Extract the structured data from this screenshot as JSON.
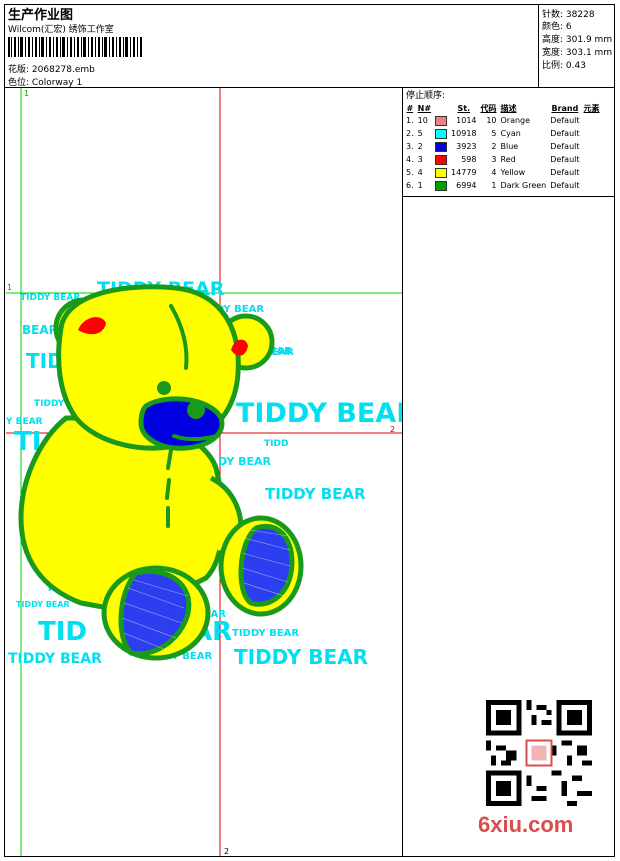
{
  "header": {
    "title": "生产作业图",
    "subtitle": "Wilcom(汇宏) 绣饰工作室",
    "design_file_label": "花版:",
    "design_file": "2068278.emb",
    "colorway_label": "色位:",
    "colorway": "Colorway 1"
  },
  "stats": {
    "stitches_label": "针数:",
    "stitches": "38228",
    "colors_label": "颜色:",
    "colors": "6",
    "height_label": "高度:",
    "height": "301.9 mm",
    "width_label": "宽度:",
    "width": "303.1 mm",
    "scale_label": "比例:",
    "scale": "0.43"
  },
  "stop_sequence": {
    "title": "停止顺序:",
    "headers": [
      "#",
      "N#",
      "St.",
      "代码",
      "描述",
      "Brand",
      "元素"
    ],
    "rows": [
      {
        "index": "1.",
        "n": "10",
        "color": "#f08080",
        "stitches": "1014",
        "code": "10",
        "desc": "Orange",
        "brand": "Default"
      },
      {
        "index": "2.",
        "n": "5",
        "color": "#00ffff",
        "stitches": "10918",
        "code": "5",
        "desc": "Cyan",
        "brand": "Default"
      },
      {
        "index": "3.",
        "n": "2",
        "color": "#0000e0",
        "stitches": "3923",
        "code": "2",
        "desc": "Blue",
        "brand": "Default"
      },
      {
        "index": "4.",
        "n": "3",
        "color": "#ff0000",
        "stitches": "598",
        "code": "3",
        "desc": "Red",
        "brand": "Default"
      },
      {
        "index": "5.",
        "n": "4",
        "color": "#ffff00",
        "stitches": "14779",
        "code": "4",
        "desc": "Yellow",
        "brand": "Default"
      },
      {
        "index": "6.",
        "n": "1",
        "color": "#00a000",
        "stitches": "6994",
        "code": "1",
        "desc": "Dark Green",
        "brand": "Default"
      }
    ]
  },
  "design": {
    "guide_labels": {
      "top": "1",
      "left": "1",
      "right": "2",
      "bottom": "2"
    },
    "texts": [
      "TIDDY BEAR",
      "TIDDY BEAR",
      "BEAR",
      "TID",
      "TIDDY",
      "Y BEAR",
      "TIDDY BEAR",
      "BEAR",
      "TIDD",
      "DY BEAR",
      "TIDDY BEAR",
      "TID",
      "TIDDY BEAR",
      "TID",
      "BEAR",
      "TIDDY BEAR",
      "TIDDY BEAR",
      "DY BEAR",
      "TIDDY BEAR",
      "TIDDY BEAR",
      "TI",
      "BEAR",
      "BEAR",
      "AR"
    ]
  },
  "watermark": "6xiu.com"
}
